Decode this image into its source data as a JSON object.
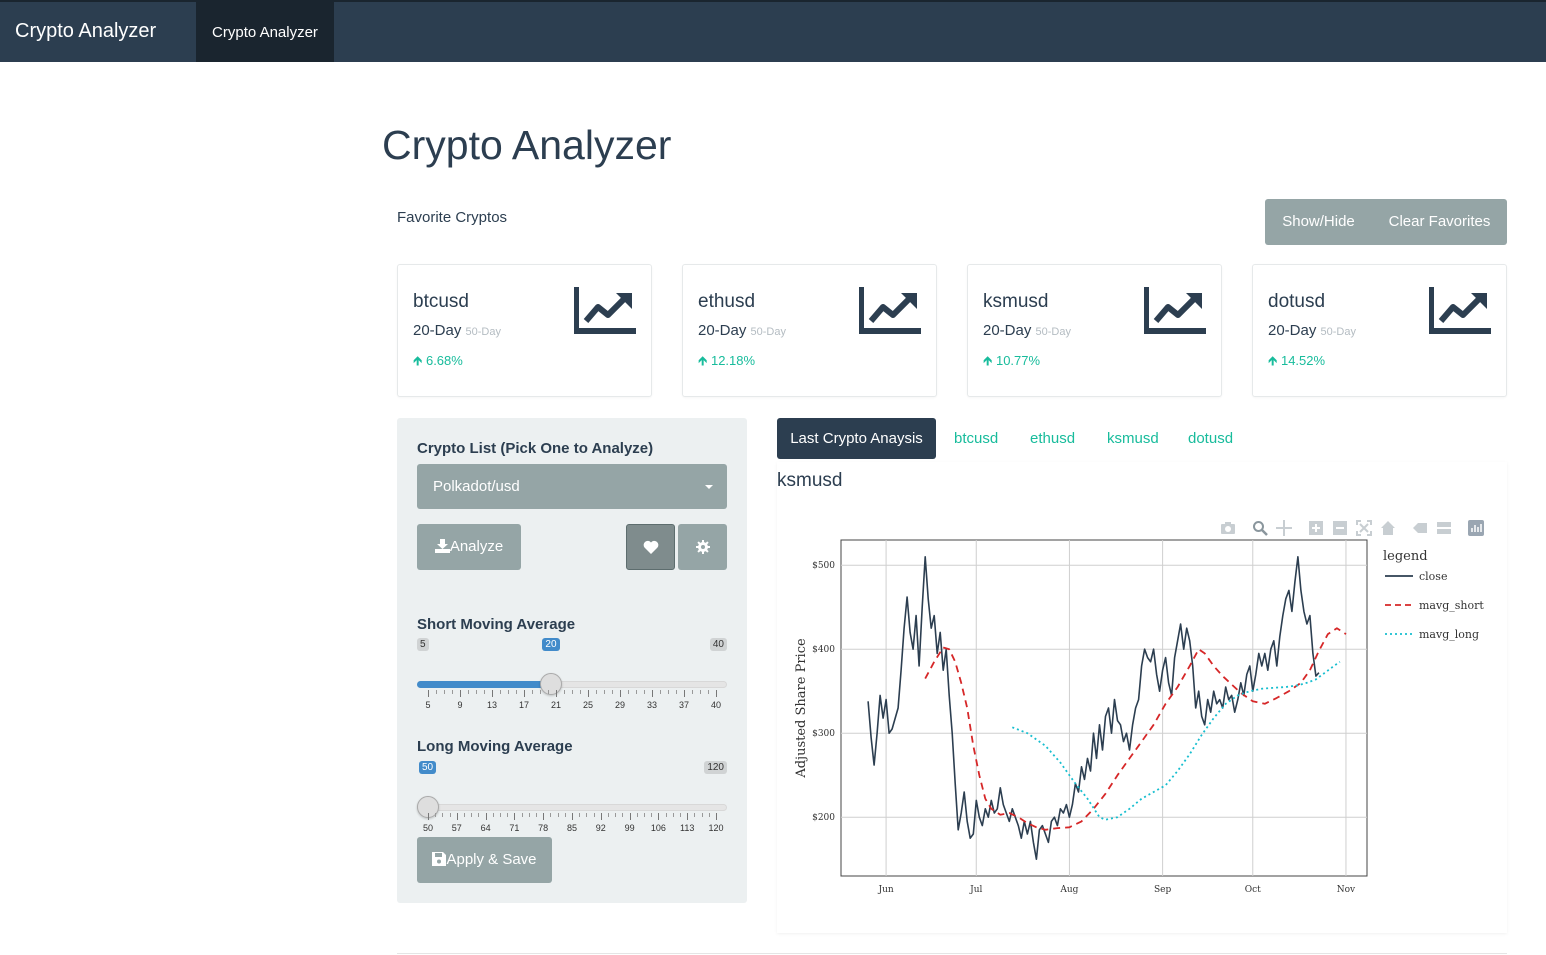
{
  "navbar": {
    "brand": "Crypto Analyzer",
    "tab": "Crypto Analyzer"
  },
  "page": {
    "title": "Crypto Analyzer",
    "favorites_label": "Favorite Cryptos"
  },
  "favorites_buttons": {
    "show_hide": "Show/Hide",
    "clear": "Clear Favorites"
  },
  "cards": [
    {
      "name": "btcusd",
      "period": "20-Day",
      "period_alt": "50-Day",
      "change": "6.68%"
    },
    {
      "name": "ethusd",
      "period": "20-Day",
      "period_alt": "50-Day",
      "change": "12.18%"
    },
    {
      "name": "ksmusd",
      "period": "20-Day",
      "period_alt": "50-Day",
      "change": "10.77%"
    },
    {
      "name": "dotusd",
      "period": "20-Day",
      "period_alt": "50-Day",
      "change": "14.52%"
    }
  ],
  "controls": {
    "list_label": "Crypto List (Pick One to Analyze)",
    "selected": "Polkadot/usd",
    "analyze": "Analyze",
    "apply": "Apply & Save",
    "short_label": "Short Moving Average",
    "short": {
      "min": "5",
      "max": "40",
      "value": "20",
      "value_num": 20,
      "min_num": 5,
      "max_num": 40,
      "ticks": [
        "5",
        "9",
        "13",
        "17",
        "21",
        "25",
        "29",
        "33",
        "37",
        "40"
      ]
    },
    "long_label": "Long Moving Average",
    "long": {
      "min": "50",
      "max": "120",
      "value": "50",
      "value_num": 50,
      "min_num": 50,
      "max_num": 120,
      "ticks": [
        "50",
        "57",
        "64",
        "71",
        "78",
        "85",
        "92",
        "99",
        "106",
        "113",
        "120"
      ]
    }
  },
  "tabs": {
    "active": "Last Crypto Anaysis",
    "items": [
      "btcusd",
      "ethusd",
      "ksmusd",
      "dotusd"
    ]
  },
  "chart_title": "ksmusd",
  "colors": {
    "navy": "#2c3e50",
    "teal": "#18bc9c",
    "gray": "#95a5a6",
    "red": "#d62728",
    "cyan": "#17becf"
  },
  "chart_data": {
    "type": "line",
    "ylabel": "Adjusted Share Price",
    "ylim": [
      130,
      530
    ],
    "xlim": [
      0,
      175
    ],
    "yticks": [
      {
        "v": 200,
        "label": "$200"
      },
      {
        "v": 300,
        "label": "$300"
      },
      {
        "v": 400,
        "label": "$400"
      },
      {
        "v": 500,
        "label": "$500"
      }
    ],
    "xticks": [
      {
        "v": 15,
        "label": "Jun"
      },
      {
        "v": 45,
        "label": "Jul"
      },
      {
        "v": 76,
        "label": "Aug"
      },
      {
        "v": 107,
        "label": "Sep"
      },
      {
        "v": 137,
        "label": "Oct"
      },
      {
        "v": 168,
        "label": "Nov"
      }
    ],
    "legend_title": "legend",
    "legend_position": "right",
    "grid": true,
    "series": [
      {
        "name": "close",
        "style": "solid",
        "color": "#2c3e50",
        "points": [
          [
            9,
            338
          ],
          [
            10,
            295
          ],
          [
            11,
            262
          ],
          [
            12,
            300
          ],
          [
            13,
            345
          ],
          [
            14,
            318
          ],
          [
            15,
            340
          ],
          [
            16,
            300
          ],
          [
            17,
            305
          ],
          [
            19,
            330
          ],
          [
            20,
            375
          ],
          [
            21,
            425
          ],
          [
            22,
            462
          ],
          [
            23,
            420
          ],
          [
            24,
            400
          ],
          [
            25,
            440
          ],
          [
            26,
            380
          ],
          [
            27,
            450
          ],
          [
            28,
            510
          ],
          [
            29,
            460
          ],
          [
            30,
            425
          ],
          [
            31,
            440
          ],
          [
            32,
            395
          ],
          [
            33,
            420
          ],
          [
            34,
            375
          ],
          [
            35,
            400
          ],
          [
            36,
            345
          ],
          [
            37,
            300
          ],
          [
            38,
            240
          ],
          [
            39,
            185
          ],
          [
            40,
            205
          ],
          [
            41,
            230
          ],
          [
            42,
            195
          ],
          [
            43,
            175
          ],
          [
            44,
            180
          ],
          [
            45,
            220
          ],
          [
            46,
            200
          ],
          [
            47,
            190
          ],
          [
            48,
            210
          ],
          [
            49,
            200
          ],
          [
            50,
            220
          ],
          [
            51,
            205
          ],
          [
            52,
            210
          ],
          [
            53,
            235
          ],
          [
            54,
            215
          ],
          [
            55,
            205
          ],
          [
            56,
            195
          ],
          [
            57,
            210
          ],
          [
            58,
            200
          ],
          [
            59,
            190
          ],
          [
            60,
            175
          ],
          [
            61,
            195
          ],
          [
            62,
            180
          ],
          [
            63,
            195
          ],
          [
            64,
            170
          ],
          [
            65,
            150
          ],
          [
            66,
            185
          ],
          [
            67,
            190
          ],
          [
            68,
            180
          ],
          [
            69,
            170
          ],
          [
            70,
            195
          ],
          [
            71,
            200
          ],
          [
            72,
            190
          ],
          [
            73,
            210
          ],
          [
            74,
            205
          ],
          [
            75,
            215
          ],
          [
            76,
            200
          ],
          [
            77,
            215
          ],
          [
            78,
            240
          ],
          [
            79,
            230
          ],
          [
            80,
            260
          ],
          [
            81,
            245
          ],
          [
            82,
            270
          ],
          [
            83,
            255
          ],
          [
            84,
            300
          ],
          [
            85,
            270
          ],
          [
            86,
            310
          ],
          [
            87,
            280
          ],
          [
            88,
            320
          ],
          [
            89,
            330
          ],
          [
            90,
            300
          ],
          [
            91,
            340
          ],
          [
            92,
            315
          ],
          [
            93,
            310
          ],
          [
            94,
            290
          ],
          [
            95,
            300
          ],
          [
            96,
            280
          ],
          [
            97,
            310
          ],
          [
            98,
            330
          ],
          [
            99,
            340
          ],
          [
            100,
            380
          ],
          [
            101,
            400
          ],
          [
            102,
            390
          ],
          [
            103,
            385
          ],
          [
            104,
            400
          ],
          [
            105,
            370
          ],
          [
            106,
            350
          ],
          [
            107,
            375
          ],
          [
            108,
            390
          ],
          [
            109,
            360
          ],
          [
            110,
            345
          ],
          [
            111,
            390
          ],
          [
            112,
            410
          ],
          [
            113,
            430
          ],
          [
            114,
            400
          ],
          [
            115,
            425
          ],
          [
            116,
            410
          ],
          [
            117,
            380
          ],
          [
            118,
            330
          ],
          [
            119,
            350
          ],
          [
            120,
            320
          ],
          [
            121,
            310
          ],
          [
            122,
            340
          ],
          [
            123,
            325
          ],
          [
            124,
            350
          ],
          [
            125,
            335
          ],
          [
            126,
            340
          ],
          [
            127,
            330
          ],
          [
            128,
            355
          ],
          [
            129,
            340
          ],
          [
            130,
            345
          ],
          [
            131,
            325
          ],
          [
            132,
            340
          ],
          [
            133,
            360
          ],
          [
            134,
            345
          ],
          [
            135,
            370
          ],
          [
            136,
            380
          ],
          [
            137,
            350
          ],
          [
            138,
            370
          ],
          [
            139,
            395
          ],
          [
            140,
            380
          ],
          [
            141,
            395
          ],
          [
            142,
            375
          ],
          [
            143,
            400
          ],
          [
            144,
            410
          ],
          [
            145,
            380
          ],
          [
            146,
            415
          ],
          [
            147,
            440
          ],
          [
            148,
            460
          ],
          [
            149,
            470
          ],
          [
            150,
            445
          ],
          [
            151,
            480
          ],
          [
            152,
            510
          ],
          [
            153,
            470
          ],
          [
            154,
            445
          ],
          [
            155,
            430
          ],
          [
            156,
            440
          ],
          [
            157,
            395
          ],
          [
            158,
            368
          ],
          [
            159,
            372
          ]
        ]
      },
      {
        "name": "mavg_short",
        "style": "dash",
        "color": "#d62728",
        "points": [
          [
            28,
            365
          ],
          [
            31,
            385
          ],
          [
            34,
            402
          ],
          [
            36,
            400
          ],
          [
            38,
            385
          ],
          [
            40,
            360
          ],
          [
            42,
            330
          ],
          [
            44,
            285
          ],
          [
            46,
            250
          ],
          [
            48,
            222
          ],
          [
            50,
            210
          ],
          [
            53,
            203
          ],
          [
            56,
            205
          ],
          [
            59,
            200
          ],
          [
            62,
            193
          ],
          [
            65,
            188
          ],
          [
            68,
            185
          ],
          [
            72,
            187
          ],
          [
            76,
            188
          ],
          [
            80,
            195
          ],
          [
            84,
            210
          ],
          [
            88,
            228
          ],
          [
            92,
            250
          ],
          [
            96,
            270
          ],
          [
            100,
            290
          ],
          [
            104,
            310
          ],
          [
            108,
            335
          ],
          [
            112,
            355
          ],
          [
            116,
            380
          ],
          [
            119,
            400
          ],
          [
            121,
            395
          ],
          [
            124,
            380
          ],
          [
            127,
            368
          ],
          [
            130,
            358
          ],
          [
            133,
            348
          ],
          [
            137,
            338
          ],
          [
            141,
            335
          ],
          [
            145,
            342
          ],
          [
            149,
            350
          ],
          [
            153,
            360
          ],
          [
            156,
            375
          ],
          [
            159,
            398
          ],
          [
            162,
            418
          ],
          [
            165,
            425
          ],
          [
            168,
            418
          ]
        ]
      },
      {
        "name": "mavg_long",
        "style": "dot",
        "color": "#17becf",
        "points": [
          [
            57,
            307
          ],
          [
            62,
            300
          ],
          [
            68,
            285
          ],
          [
            73,
            265
          ],
          [
            78,
            240
          ],
          [
            82,
            222
          ],
          [
            86,
            200
          ],
          [
            88,
            197
          ],
          [
            92,
            200
          ],
          [
            96,
            210
          ],
          [
            100,
            222
          ],
          [
            104,
            230
          ],
          [
            108,
            238
          ],
          [
            112,
            255
          ],
          [
            116,
            275
          ],
          [
            120,
            298
          ],
          [
            124,
            318
          ],
          [
            128,
            335
          ],
          [
            132,
            345
          ],
          [
            136,
            350
          ],
          [
            140,
            353
          ],
          [
            144,
            354
          ],
          [
            148,
            355
          ],
          [
            152,
            357
          ],
          [
            155,
            360
          ],
          [
            158,
            364
          ],
          [
            161,
            372
          ],
          [
            164,
            380
          ],
          [
            166,
            385
          ]
        ]
      }
    ]
  }
}
